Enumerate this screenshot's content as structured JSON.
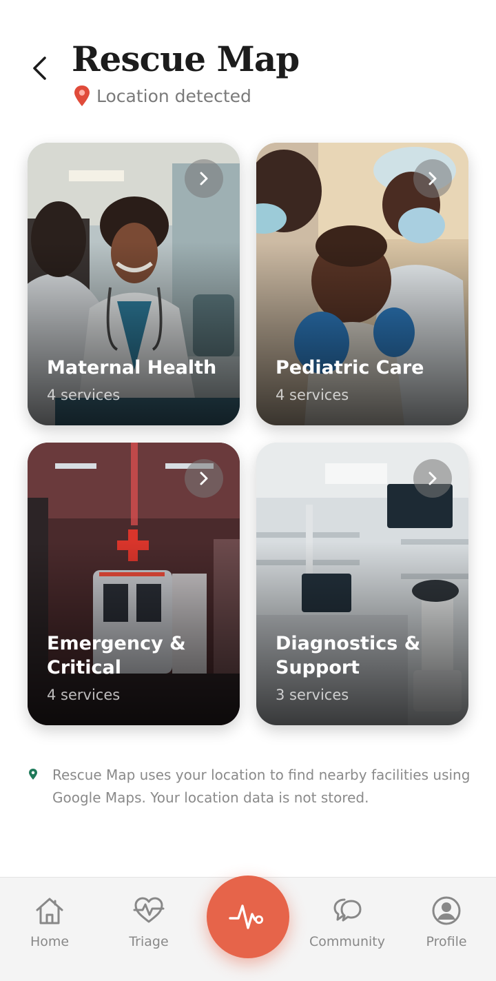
{
  "header": {
    "title": "Rescue Map",
    "location_status": "Location detected"
  },
  "categories": [
    {
      "label": "Maternal Health",
      "count": "4 services"
    },
    {
      "label": "Pediatric Care",
      "count": "4 services"
    },
    {
      "label": "Emergency & Critical",
      "count": "4 services"
    },
    {
      "label": "Diagnostics & Support",
      "count": "3 services"
    }
  ],
  "notice": {
    "text": "Rescue Map uses your location to find nearby facilities using Google Maps. Your location data is not stored."
  },
  "nav": {
    "home": "Home",
    "triage": "Triage",
    "community": "Community",
    "profile": "Profile"
  },
  "colors": {
    "accent": "#e6644a",
    "pin_red": "#e04b3a",
    "notice_pin": "#1f7a5a"
  }
}
